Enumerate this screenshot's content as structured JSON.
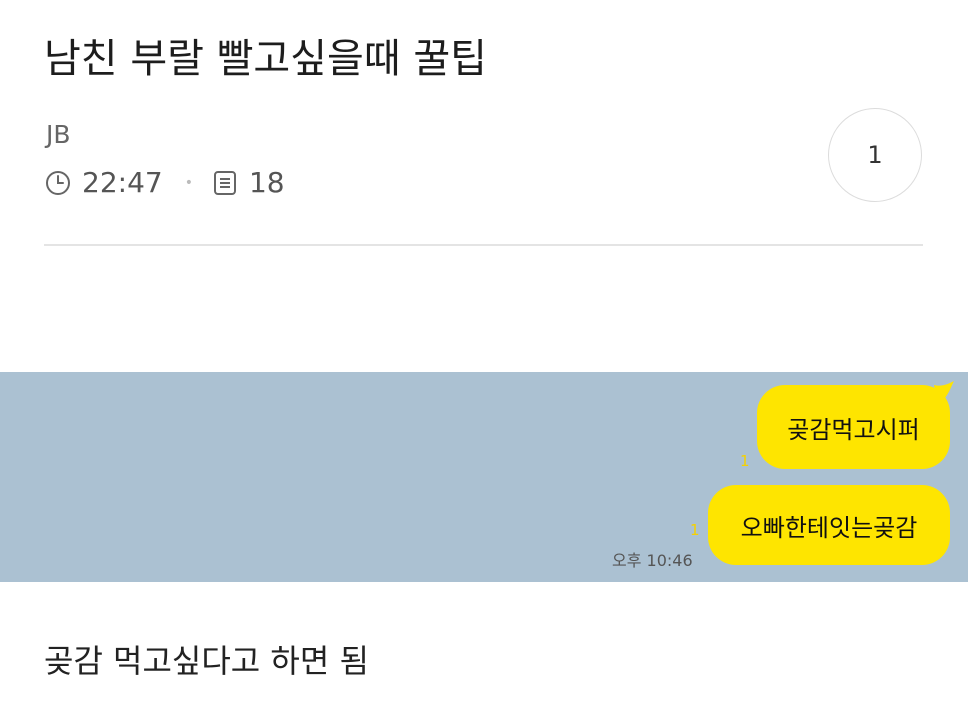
{
  "post": {
    "title": "남친 부랄 빨고싶을때 꿀팁",
    "author": "JB",
    "time": "22:47",
    "comment_count": "18",
    "like_count": "1",
    "body_text": "곶감 먹고싶다고 하면 됨"
  },
  "icons": {
    "time": "clock-icon",
    "count": "document-icon"
  },
  "chat": {
    "messages": [
      {
        "text": "곶감먹고시퍼",
        "read_count": "1"
      },
      {
        "text": "오빠한테잇는곶감",
        "read_count": "1"
      }
    ],
    "timestamp": "오후 10:46"
  },
  "colors": {
    "chat_background": "#abc1d2",
    "bubble": "#fee500",
    "read_count": "#f5d100"
  }
}
